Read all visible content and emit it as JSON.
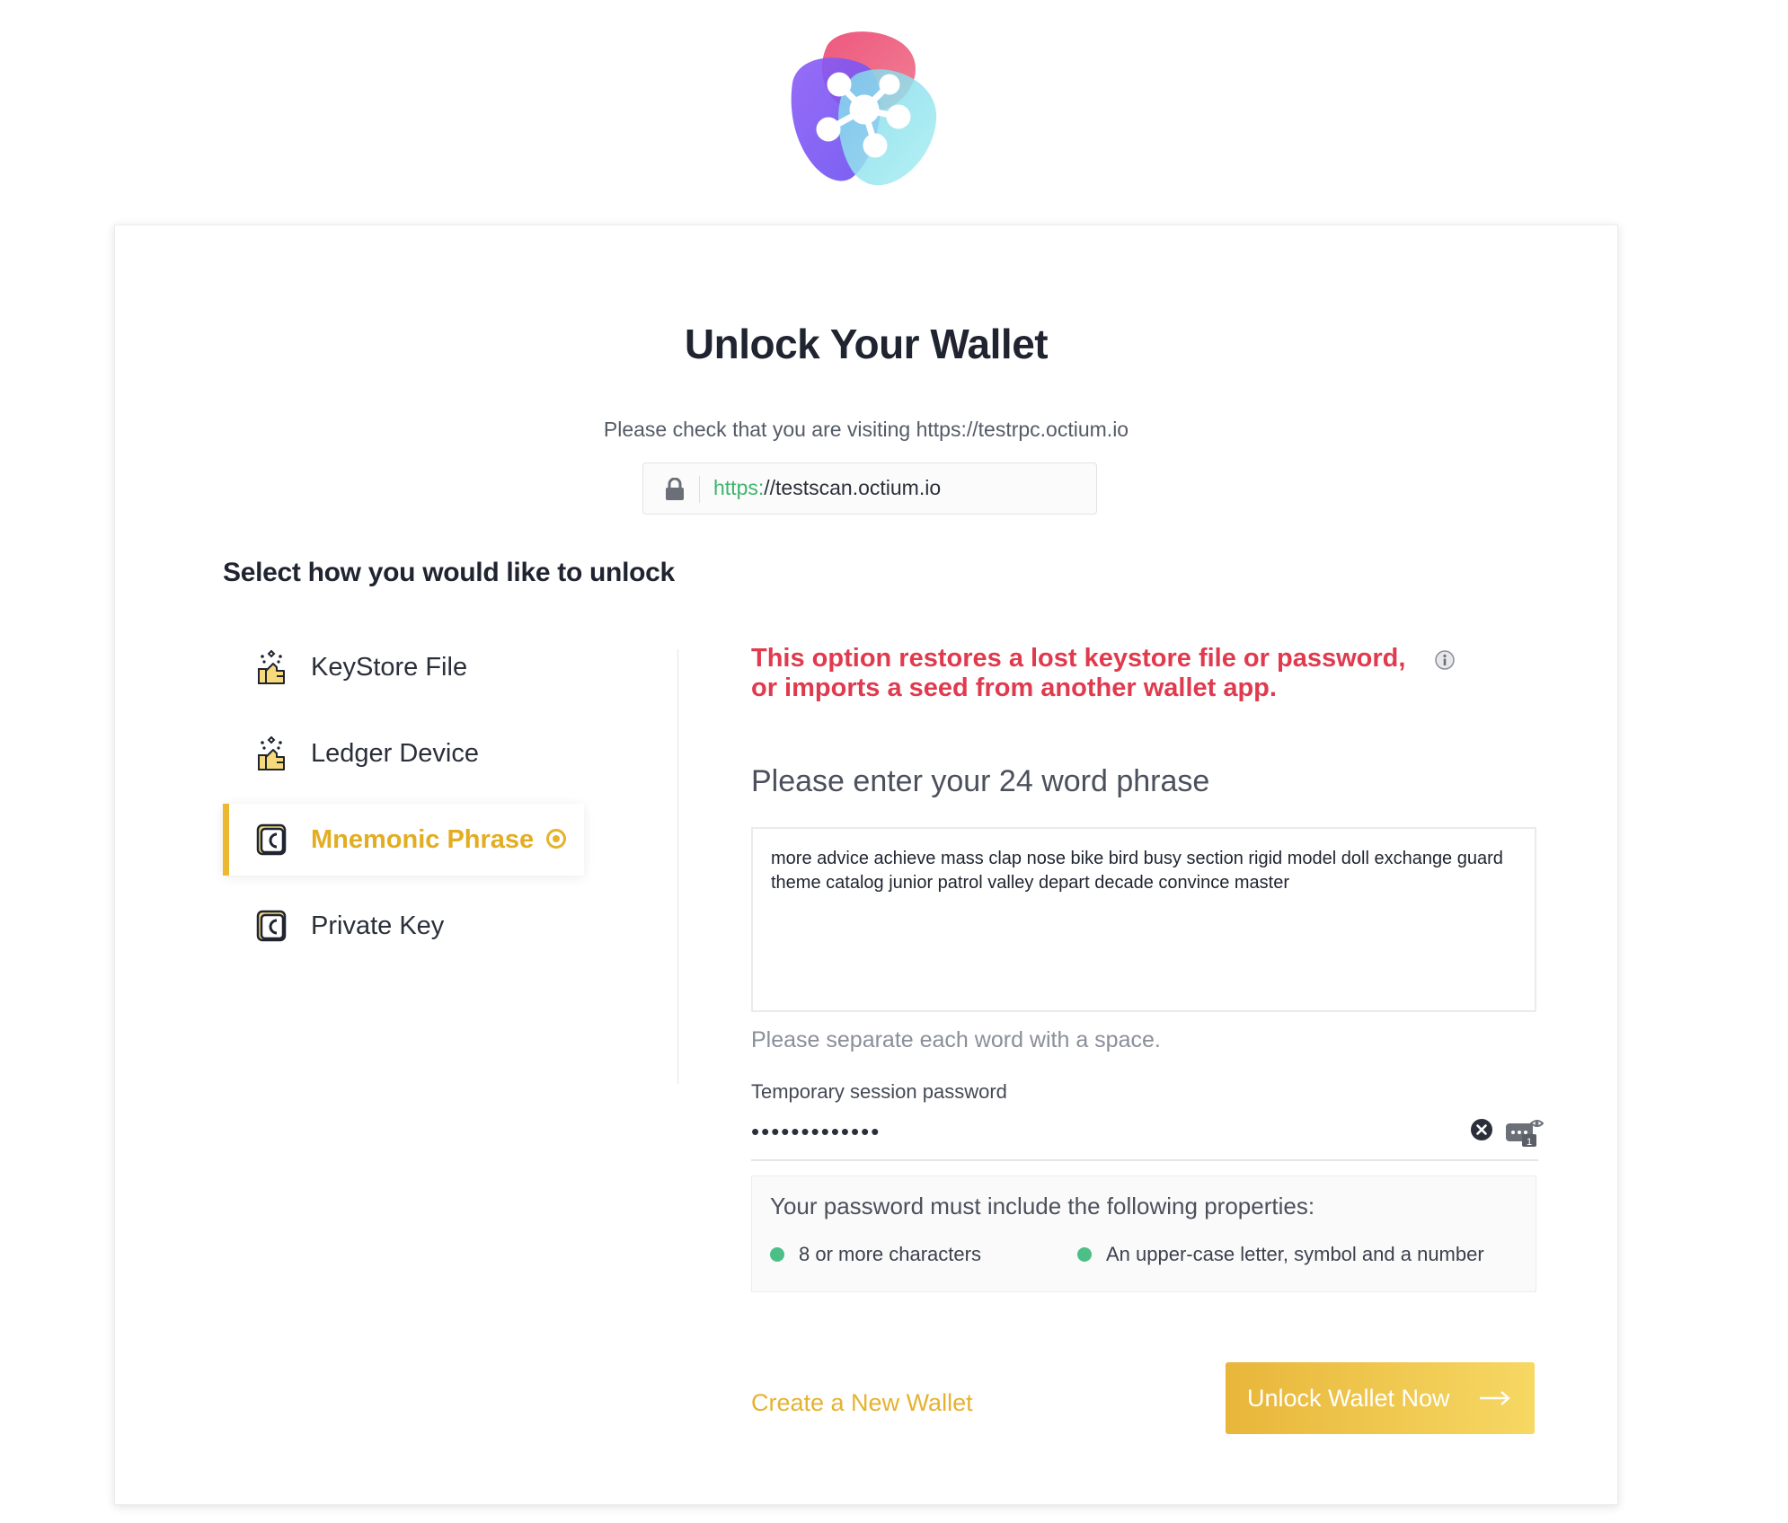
{
  "header": {
    "logo": "octium-logo-network-icon"
  },
  "card": {
    "title": "Unlock Your Wallet",
    "subtitle": "Please check that you are visiting https://testrpc.octium.io",
    "url_scheme": "https:",
    "url_rest": "//testscan.octium.io",
    "select_label": "Select how you would like to unlock"
  },
  "options": [
    {
      "label": "KeyStore File",
      "icon": "keystore-icon",
      "selected": false
    },
    {
      "label": "Ledger Device",
      "icon": "ledger-icon",
      "selected": false
    },
    {
      "label": "Mnemonic Phrase",
      "icon": "mnemonic-icon",
      "selected": true
    },
    {
      "label": "Private Key",
      "icon": "private-key-icon",
      "selected": false
    }
  ],
  "panel": {
    "warning_line1": "This option restores a lost keystore file or password,",
    "warning_line2": "or imports a seed from another wallet app.",
    "phrase_label": "Please enter your 24 word phrase",
    "phrase_value": "more advice achieve mass clap nose bike bird busy section rigid model doll exchange guard theme catalog junior patrol valley depart decade convince master",
    "phrase_hint": "Please separate each word with a space.",
    "password_label": "Temporary session password",
    "password_value": "•••••••••••••",
    "rules_title": "Your password must include the following properties:",
    "rule1": "8 or more characters",
    "rule2": "An upper-case letter, symbol and a number",
    "create_link": "Create a New Wallet",
    "unlock_button": "Unlock Wallet Now"
  },
  "colors": {
    "accent": "#e6b22e",
    "warning": "#e03a4e",
    "url_scheme": "#3db56b",
    "rule_dot": "#4cbf86"
  }
}
